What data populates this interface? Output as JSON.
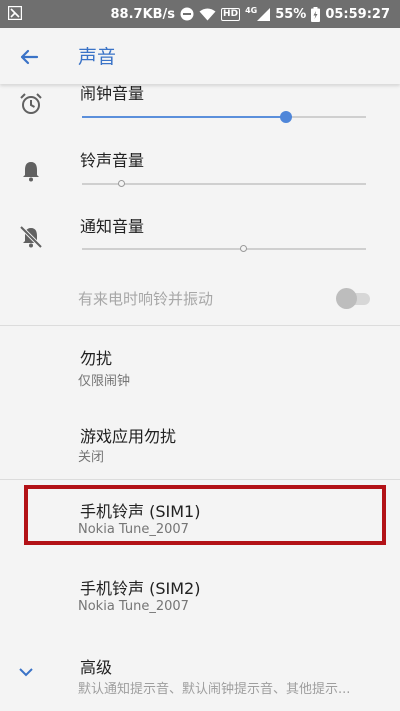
{
  "status_bar": {
    "speed": "88.7KB/s",
    "hd": "HD",
    "network": "4G",
    "battery": "55%",
    "time": "05:59:27"
  },
  "app_bar": {
    "title": "声音"
  },
  "volume": {
    "alarm": {
      "label": "闹钟音量",
      "level": 0.72
    },
    "ring": {
      "label": "铃声音量",
      "level": 0.14
    },
    "notification": {
      "label": "通知音量",
      "level": 0.57
    }
  },
  "vibrate": {
    "label": "有来电时响铃并振动",
    "enabled": false
  },
  "dnd": {
    "label": "勿扰",
    "value": "仅限闹钟"
  },
  "game_dnd": {
    "label": "游戏应用勿扰",
    "value": "关闭"
  },
  "ringtone_sim1": {
    "label": "手机铃声 (SIM1)",
    "value": "Nokia Tune_2007"
  },
  "ringtone_sim2": {
    "label": "手机铃声 (SIM2)",
    "value": "Nokia Tune_2007"
  },
  "advanced": {
    "label": "高级",
    "summary": "默认通知提示音、默认闹钟提示音、其他提示..."
  },
  "colors": {
    "accent": "#3a73c7",
    "highlight": "#b31217",
    "status_bar": "#6f6f6f"
  },
  "icons": [
    "alarm-icon",
    "bell-icon",
    "bell-off-icon",
    "back-arrow-icon",
    "chevron-down-icon"
  ]
}
